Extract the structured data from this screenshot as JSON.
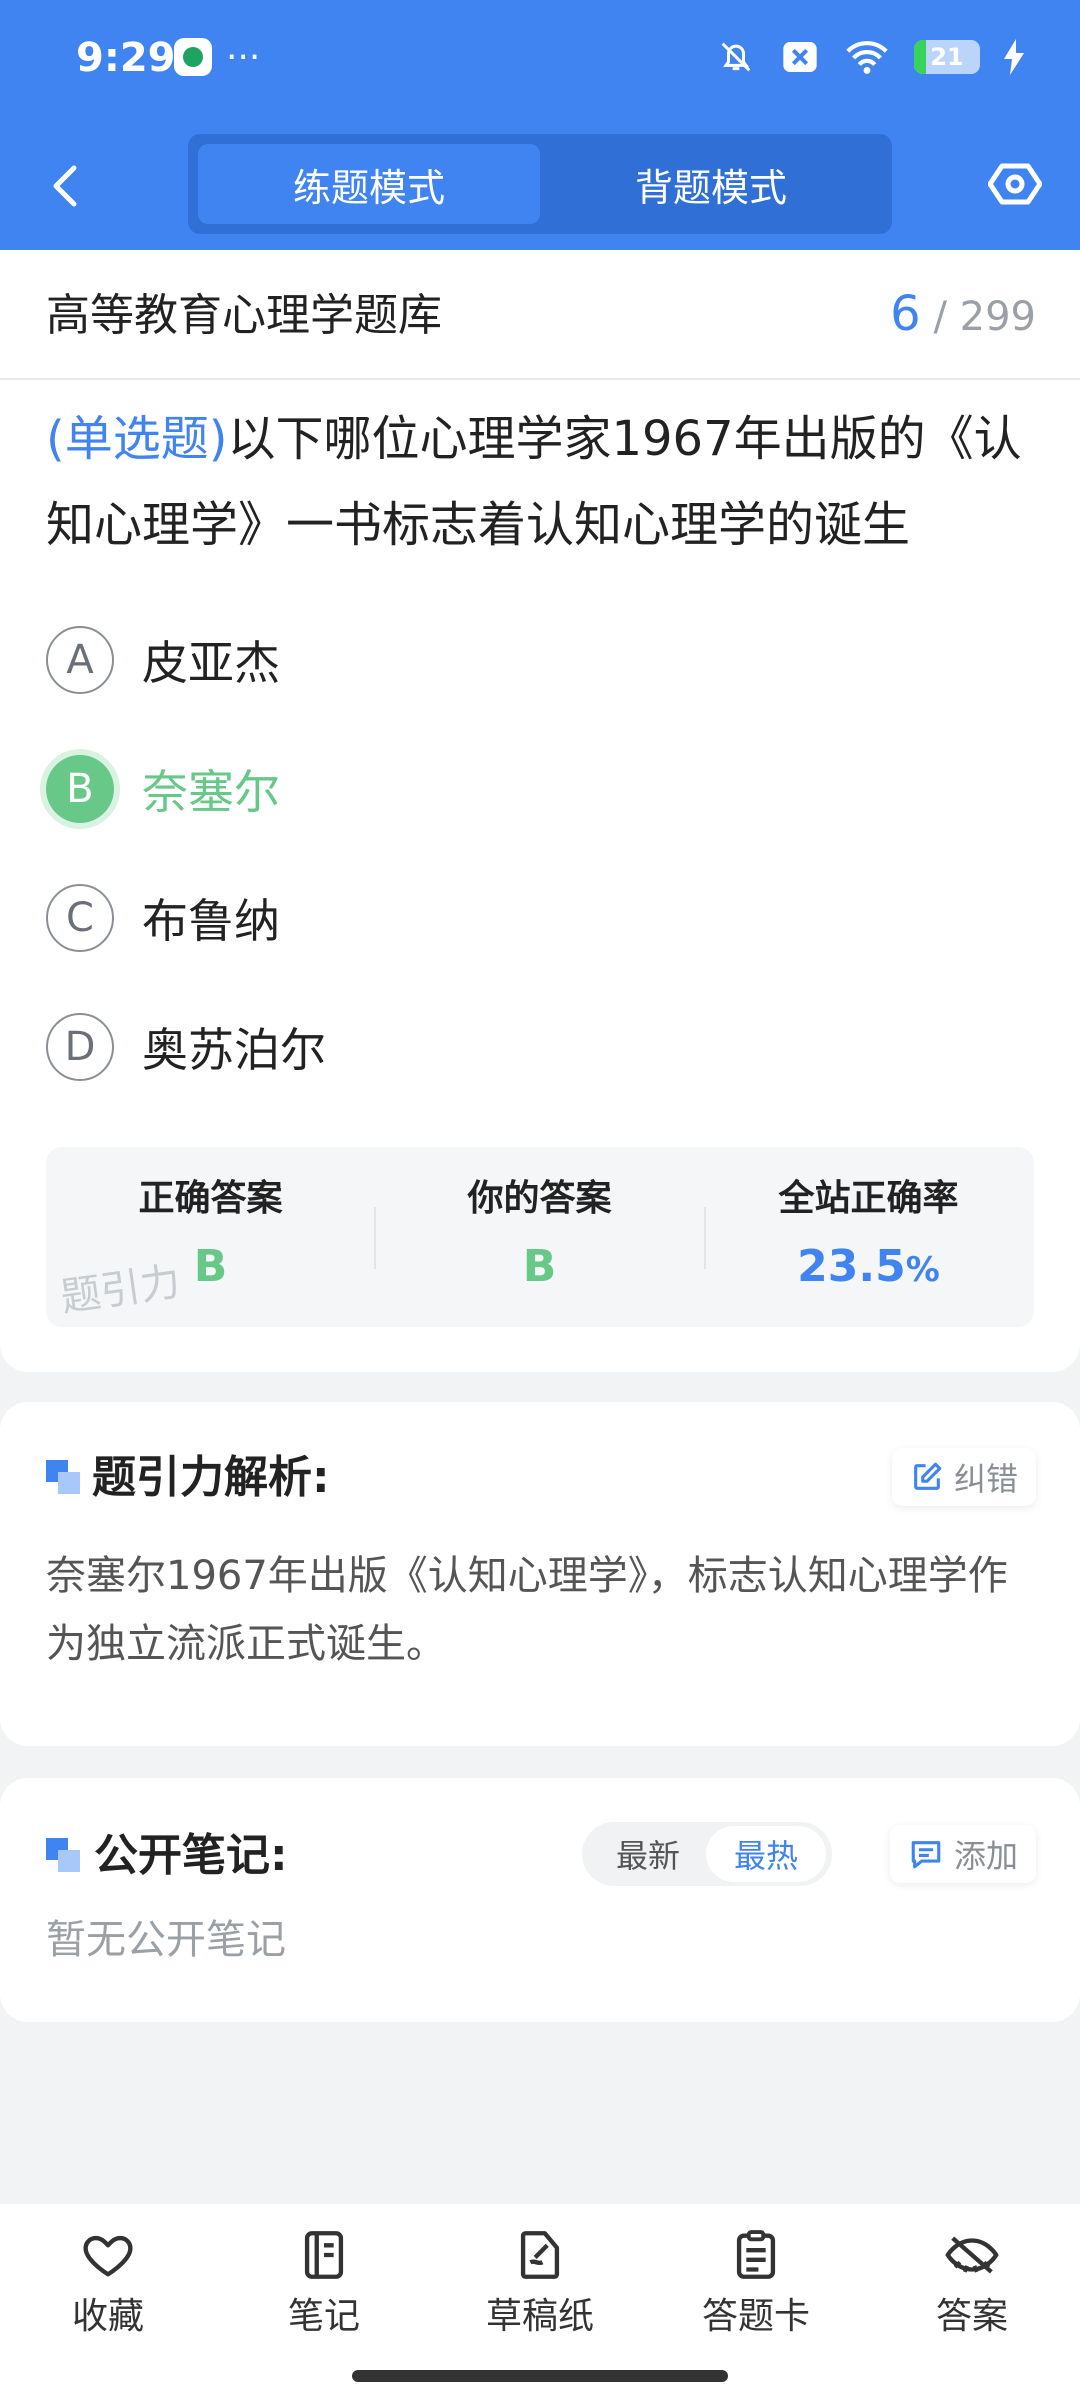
{
  "status_bar": {
    "time": "9:29",
    "more": "···",
    "battery": "21"
  },
  "header": {
    "modes": [
      "练题模式",
      "背题模式"
    ],
    "active_mode": "练题模式"
  },
  "question_card": {
    "bank_title": "高等教育心理学题库",
    "current": "6",
    "sep": "/",
    "total": "299",
    "question_type": "(单选题)",
    "question_text": "以下哪位心理学家1967年出版的《认知心理学》一书标志着认知心理学的诞生",
    "options": [
      {
        "letter": "A",
        "text": "皮亚杰"
      },
      {
        "letter": "B",
        "text": "奈塞尔",
        "selected": true
      },
      {
        "letter": "C",
        "text": "布鲁纳"
      },
      {
        "letter": "D",
        "text": "奥苏泊尔"
      }
    ],
    "answers": {
      "correct_label": "正确答案",
      "correct_value": "B",
      "yours_label": "你的答案",
      "yours_value": "B",
      "rate_label": "全站正确率",
      "rate_value": "23.5",
      "rate_unit": "%"
    },
    "watermark": "题引力"
  },
  "analysis": {
    "title": "题引力解析:",
    "report_label": "纠错",
    "text": "奈塞尔1967年出版《认知心理学》，标志认知心理学作为独立流派正式诞生。"
  },
  "notes": {
    "title": "公开笔记:",
    "sort_newest": "最新",
    "sort_hottest": "最热",
    "active_sort": "最热",
    "add_label": "添加",
    "empty_text": "暂无公开笔记"
  },
  "bottom_bar": {
    "tabs": [
      {
        "label": "收藏",
        "icon": "heart-icon"
      },
      {
        "label": "笔记",
        "icon": "notebook-icon"
      },
      {
        "label": "草稿纸",
        "icon": "draft-icon"
      },
      {
        "label": "答题卡",
        "icon": "answer-card-icon"
      },
      {
        "label": "答案",
        "icon": "eye-off-icon"
      }
    ]
  },
  "colors": {
    "primary": "#3f84f1",
    "correct": "#67c888",
    "background": "#f2f3f5"
  }
}
